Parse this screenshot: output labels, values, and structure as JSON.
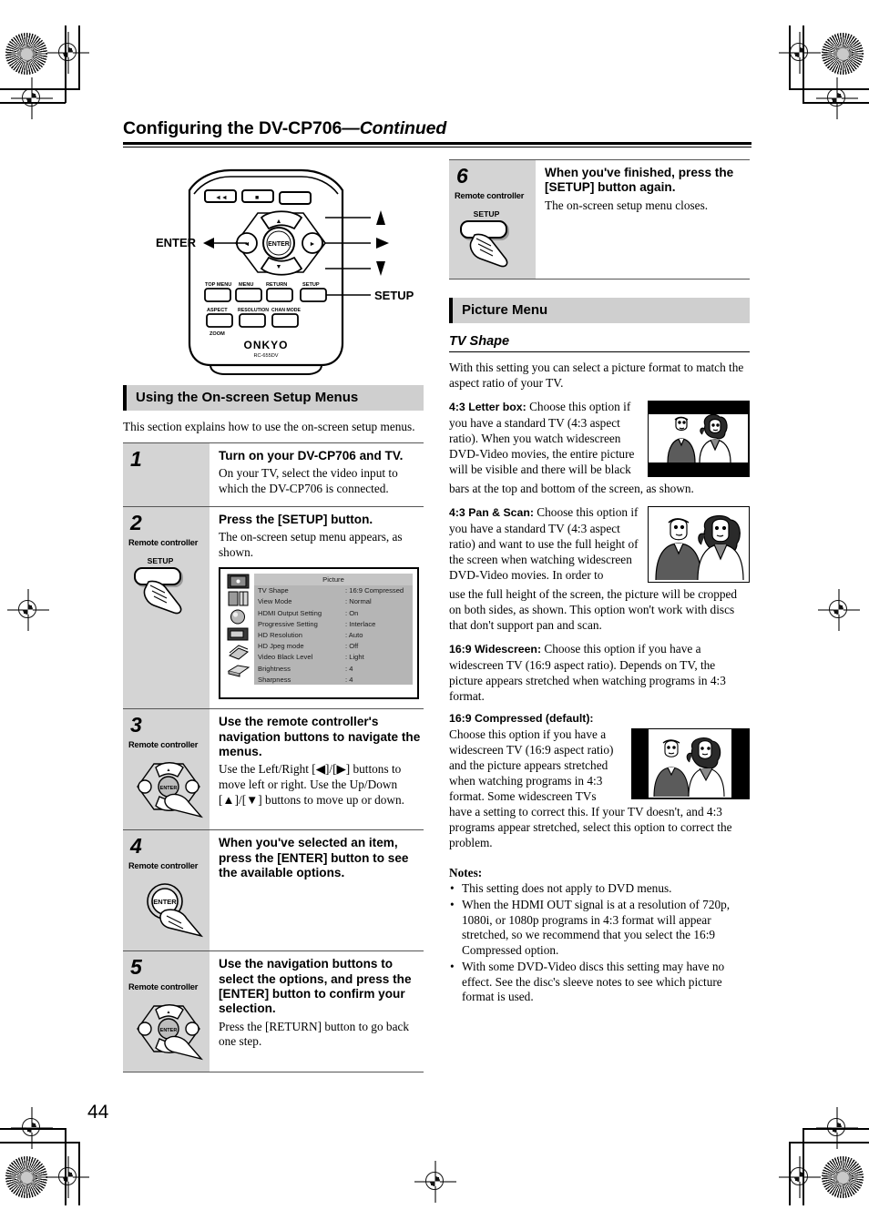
{
  "header": {
    "title": "Configuring the DV-CP706",
    "continued": "—Continued"
  },
  "page_number": "44",
  "remote_figure": {
    "callout_enter": "ENTER",
    "callout_setup": "SETUP",
    "callout_up": "▲",
    "callout_down": "▼",
    "callout_left": "◀",
    "callout_right": "▶",
    "buttons_row1": [
      "TOP MENU",
      "MENU",
      "RETURN",
      "SETUP"
    ],
    "buttons_row2": [
      "ASPECT",
      "RESOLUTION",
      "CHAN MODE"
    ],
    "zoom_label": "ZOOM",
    "brand": "ONKYO",
    "model": "RC-655DV",
    "center_button": "ENTER"
  },
  "left_section": {
    "heading": "Using the On-screen Setup Menus",
    "intro": "This section explains how to use the on-screen setup menus.",
    "remote_controller_label": "Remote controller",
    "setup_button_label": "SETUP",
    "enter_button_label": "ENTER",
    "steps": [
      {
        "num": "1",
        "title": "Turn on your DV-CP706 and TV.",
        "text": "On your TV, select the video input to which the DV-CP706 is connected.",
        "has_remote": false,
        "illustration": "none"
      },
      {
        "num": "2",
        "title": "Press the [SETUP] button.",
        "text": "The on-screen setup menu appears, as shown.",
        "has_remote": true,
        "illustration": "setup-button"
      },
      {
        "num": "3",
        "title": "Use the remote controller's navigation buttons to navigate the menus.",
        "text": "Use the Left/Right [◀]/[▶] buttons to move left or right. Use the Up/Down [▲]/[▼] buttons to move up or down.",
        "has_remote": true,
        "illustration": "nav-pad"
      },
      {
        "num": "4",
        "title": "When you've selected an item, press the [ENTER] button to see the available options.",
        "text": "",
        "has_remote": true,
        "illustration": "enter-button"
      },
      {
        "num": "5",
        "title": "Use the navigation buttons to select the options, and press the [ENTER] button to confirm your selection.",
        "text": "Press the [RETURN] button to go back one step.",
        "has_remote": true,
        "illustration": "nav-pad"
      }
    ]
  },
  "osd_menu": {
    "title": "Picture",
    "rows": [
      {
        "label": "TV Shape",
        "value": ": 16:9 Compressed"
      },
      {
        "label": "View Mode",
        "value": ": Normal"
      },
      {
        "label": "HDMI Output Setting",
        "value": ": On"
      },
      {
        "label": "Progressive Setting",
        "value": ": Interlace"
      },
      {
        "label": "HD Resolution",
        "value": ": Auto"
      },
      {
        "label": "HD Jpeg mode",
        "value": ": Off"
      },
      {
        "label": "Video Black Level",
        "value": ": Light"
      },
      {
        "label": "Brightness",
        "value": ": 4"
      },
      {
        "label": "Sharpness",
        "value": ": 4"
      }
    ],
    "icons": [
      "picture-icon",
      "speakers-icon",
      "sphere-icon",
      "display-icon",
      "disc-stack-icon",
      "player-icon"
    ]
  },
  "right_section": {
    "step6": {
      "num": "6",
      "title": "When you've finished, press the [SETUP] button again.",
      "text": "The on-screen setup menu closes.",
      "remote_controller_label": "Remote controller",
      "setup_button_label": "SETUP"
    },
    "picture_menu_heading": "Picture Menu",
    "tv_shape_heading": "TV Shape",
    "tv_shape_intro": "With this setting you can select a picture format to match the aspect ratio of your TV.",
    "options": [
      {
        "term": "4:3 Letter box:",
        "text_wrapped": "Choose this option if you have a standard TV (4:3 aspect ratio). When you watch widescreen DVD-Video movies, the entire picture will be visible and there will be black",
        "text_full_width": "bars at the top and bottom of the screen, as shown.",
        "picture": "letterbox"
      },
      {
        "term": "4:3 Pan & Scan:",
        "text_wrapped": "Choose this option if you have a standard TV (4:3 aspect ratio) and want to use the full height of the screen when watching widescreen DVD-Video movies. In order to",
        "text_full_width": "use the full height of the screen, the picture will be cropped on both sides, as shown. This option won't work with discs that don't support pan and scan.",
        "picture": "panscan"
      },
      {
        "term": "16:9 Widescreen:",
        "text_wrapped": "",
        "text_full_width": "Choose this option if you have a widescreen TV (16:9 aspect ratio). Depends on TV, the picture appears stretched when watching programs in 4:3 format.",
        "picture": "none"
      },
      {
        "term": "16:9 Compressed (default):",
        "text_wrapped": "Choose this option if you have a widescreen TV (16:9 aspect ratio) and the picture appears stretched when watching programs in 4:3 format. Some widescreen TVs",
        "text_full_width": "have a setting to correct this. If your TV doesn't, and 4:3 programs appear stretched, select this option to correct the problem.",
        "picture": "compressed"
      }
    ],
    "notes_heading": "Notes:",
    "notes": [
      "This setting does not apply to DVD menus.",
      "When the HDMI OUT signal is at a resolution of 720p, 1080i, or 1080p programs in 4:3 format will appear stretched, so we recommend that you select the 16:9 Compressed option.",
      "With some DVD-Video discs this setting may have no effect. See the disc's sleeve notes to see which picture format is used."
    ]
  },
  "colors": {
    "section_heading_bg": "#cfcfcf",
    "step_num_bg": "#d4d4d4",
    "osd_bg": "#b5b5b5",
    "rule": "#000000"
  }
}
